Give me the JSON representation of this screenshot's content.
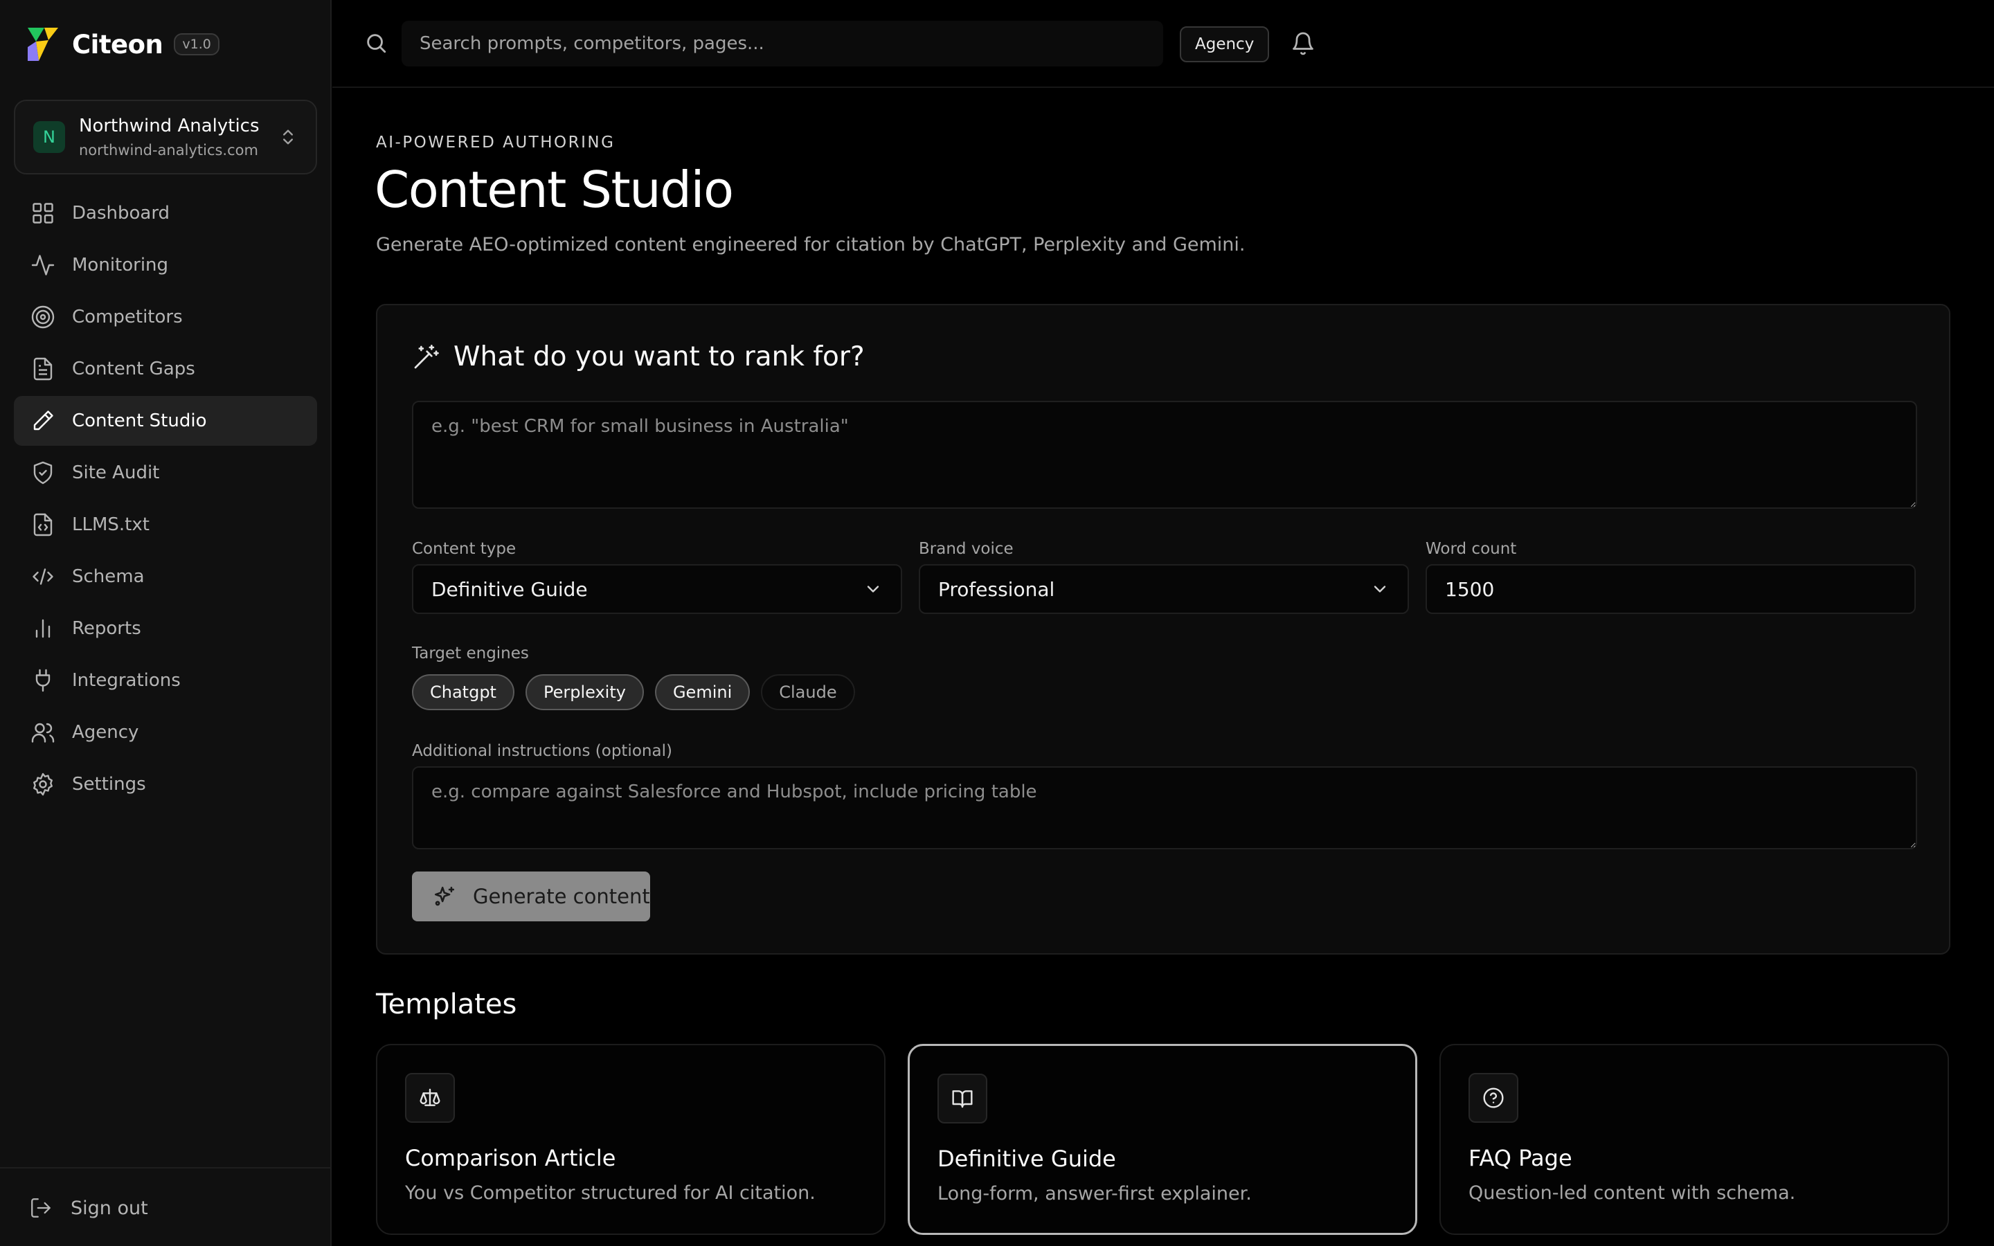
{
  "brand": {
    "name": "Citeon",
    "version": "v1.0"
  },
  "workspace": {
    "initial": "N",
    "name": "Northwind Analytics",
    "domain": "northwind-analytics.com"
  },
  "nav": [
    {
      "label": "Dashboard",
      "icon": "grid-icon"
    },
    {
      "label": "Monitoring",
      "icon": "activity-icon"
    },
    {
      "label": "Competitors",
      "icon": "target-icon"
    },
    {
      "label": "Content Gaps",
      "icon": "file-text-icon"
    },
    {
      "label": "Content Studio",
      "icon": "pen-icon",
      "active": true
    },
    {
      "label": "Site Audit",
      "icon": "shield-check-icon"
    },
    {
      "label": "LLMS.txt",
      "icon": "file-code-icon"
    },
    {
      "label": "Schema",
      "icon": "code-icon"
    },
    {
      "label": "Reports",
      "icon": "bar-chart-icon"
    },
    {
      "label": "Integrations",
      "icon": "plug-icon"
    },
    {
      "label": "Agency",
      "icon": "users-icon"
    },
    {
      "label": "Settings",
      "icon": "gear-icon"
    }
  ],
  "signout": {
    "label": "Sign out"
  },
  "topbar": {
    "search_placeholder": "Search prompts, competitors, pages...",
    "agency_label": "Agency"
  },
  "page": {
    "eyebrow": "AI-POWERED AUTHORING",
    "title": "Content Studio",
    "subtitle": "Generate AEO-optimized content engineered for citation by ChatGPT, Perplexity and Gemini."
  },
  "form": {
    "heading": "What do you want to rank for?",
    "rank_placeholder": "e.g. \"best CRM for small business in Australia\"",
    "content_type": {
      "label": "Content type",
      "value": "Definitive Guide"
    },
    "brand_voice": {
      "label": "Brand voice",
      "value": "Professional"
    },
    "word_count": {
      "label": "Word count",
      "value": "1500"
    },
    "engines_label": "Target engines",
    "engines": [
      {
        "label": "Chatgpt",
        "selected": true
      },
      {
        "label": "Perplexity",
        "selected": true
      },
      {
        "label": "Gemini",
        "selected": true
      },
      {
        "label": "Claude",
        "selected": false
      }
    ],
    "instructions_label": "Additional instructions (optional)",
    "instructions_placeholder": "e.g. compare against Salesforce and Hubspot, include pricing table",
    "generate_label": "Generate content"
  },
  "templates": {
    "title": "Templates",
    "items": [
      {
        "title": "Comparison Article",
        "desc": "You vs Competitor structured for AI citation.",
        "icon": "scale-icon",
        "selected": false
      },
      {
        "title": "Definitive Guide",
        "desc": "Long-form, answer-first explainer.",
        "icon": "book-open-icon",
        "selected": true
      },
      {
        "title": "FAQ Page",
        "desc": "Question-led content with schema.",
        "icon": "help-circle-icon",
        "selected": false
      }
    ]
  },
  "colors": {
    "background": "#000000",
    "sidebar": "#101010",
    "active_nav": "#222222",
    "workspace_avatar": "#0f3d29",
    "workspace_avatar_text": "#34d399",
    "generate_button": "#8a8a8a",
    "logo_purple": "#8b7cf6",
    "logo_yellow": "#facc15",
    "logo_green": "#22c55e"
  }
}
